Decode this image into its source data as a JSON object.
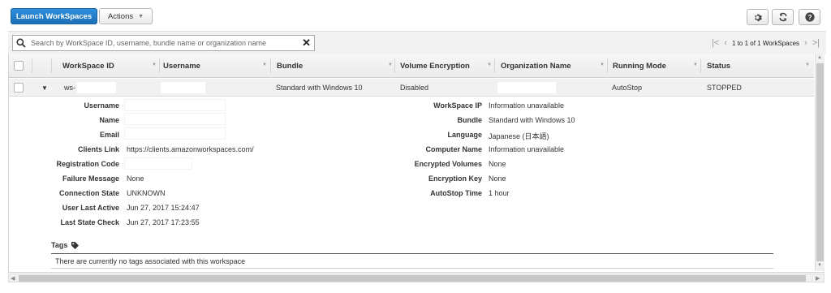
{
  "toolbar": {
    "launch_label": "Launch WorkSpaces",
    "actions_label": "Actions",
    "settings_icon": "gear-icon",
    "refresh_icon": "refresh-icon",
    "help_icon": "help-icon"
  },
  "search": {
    "placeholder": "Search by WorkSpace ID, username, bundle name or organization name",
    "value": ""
  },
  "pager": {
    "text": "1 to 1 of 1 WorkSpaces"
  },
  "table": {
    "columns": [
      "WorkSpace ID",
      "Username",
      "Bundle",
      "Volume Encryption",
      "Organization Name",
      "Running Mode",
      "Status"
    ],
    "row": {
      "workspace_id": "ws-",
      "username": "",
      "bundle": "Standard with Windows 10",
      "volume_encryption": "Disabled",
      "organization_name": "",
      "running_mode": "AutoStop",
      "status": "STOPPED"
    }
  },
  "details": {
    "left": [
      {
        "label": "Username",
        "value": ""
      },
      {
        "label": "Name",
        "value": ""
      },
      {
        "label": "Email",
        "value": ""
      },
      {
        "label": "Clients Link",
        "value": "https://clients.amazonworkspaces.com/"
      },
      {
        "label": "Registration Code",
        "value": ""
      },
      {
        "label": "Failure Message",
        "value": "None"
      },
      {
        "label": "Connection State",
        "value": "UNKNOWN"
      },
      {
        "label": "User Last Active",
        "value": "Jun 27, 2017 15:24:47"
      },
      {
        "label": "Last State Check",
        "value": "Jun 27, 2017 17:23:55"
      }
    ],
    "right": [
      {
        "label": "WorkSpace IP",
        "value": "Information unavailable"
      },
      {
        "label": "Bundle",
        "value": "Standard with Windows 10"
      },
      {
        "label": "Language",
        "value": "Japanese (日本語)"
      },
      {
        "label": "Computer Name",
        "value": "Information unavailable"
      },
      {
        "label": "Encrypted Volumes",
        "value": "None"
      },
      {
        "label": "Encryption Key",
        "value": "None"
      },
      {
        "label": "AutoStop Time",
        "value": "1 hour"
      }
    ],
    "tags_label": "Tags",
    "tags_empty": "There are currently no tags associated with this workspace"
  }
}
